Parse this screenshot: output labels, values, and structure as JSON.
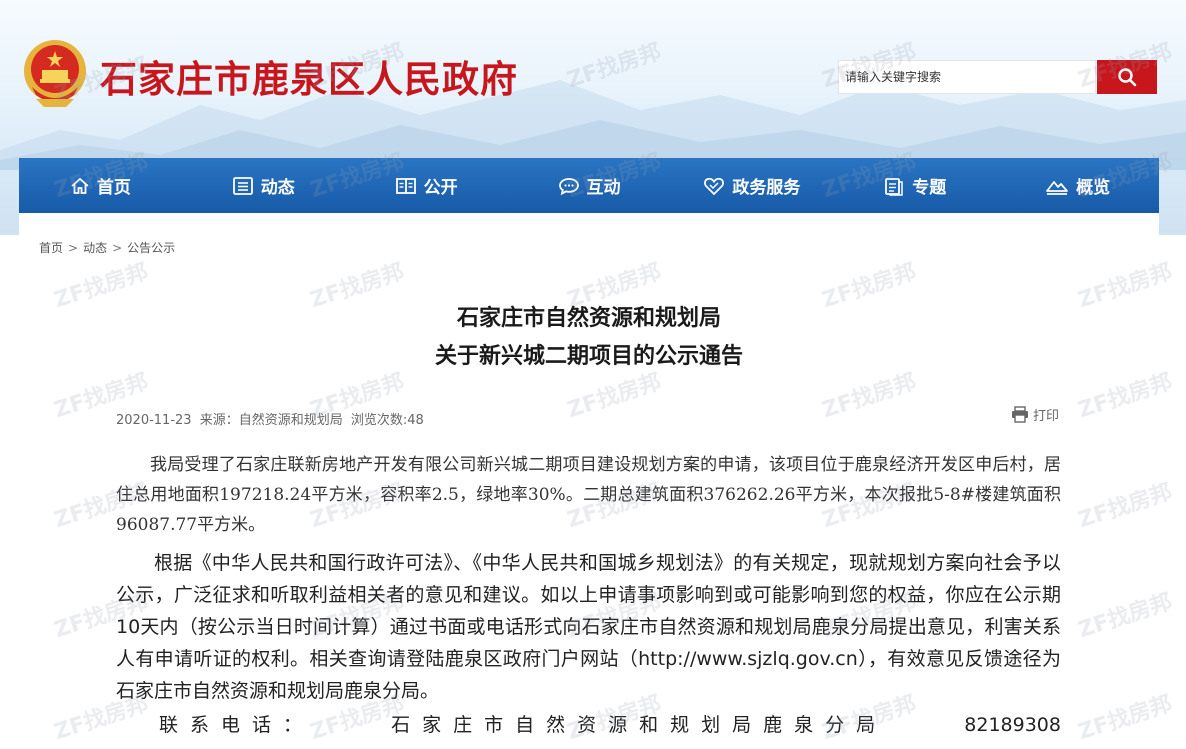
{
  "header": {
    "site_title": "石家庄市鹿泉区人民政府",
    "search_placeholder": "请输入关键字搜索",
    "brand_red": "#c8161d",
    "nav_blue": "#1d63b0"
  },
  "nav": {
    "items": [
      {
        "label": "首页",
        "icon": "home-icon"
      },
      {
        "label": "动态",
        "icon": "news-icon"
      },
      {
        "label": "公开",
        "icon": "book-icon"
      },
      {
        "label": "互动",
        "icon": "chat-icon"
      },
      {
        "label": "政务服务",
        "icon": "heart-icon"
      },
      {
        "label": "专题",
        "icon": "document-icon"
      },
      {
        "label": "概览",
        "icon": "landscape-icon"
      }
    ]
  },
  "breadcrumb": {
    "home": "首页",
    "section": "动态",
    "current": "公告公示",
    "separator": ">"
  },
  "article": {
    "title_line1": "石家庄市自然资源和规划局",
    "title_line2": "关于新兴城二期项目的公示通告",
    "date": "2020-11-23",
    "source": "来源：自然资源和规划局",
    "views": "浏览次数:48",
    "print_label": "打印",
    "paragraph1": "我局受理了石家庄联新房地产开发有限公司新兴城二期项目建设规划方案的申请，该项目位于鹿泉经济开发区申后村，居住总用地面积197218.24平方米，容积率2.5，绿地率30%。二期总建筑面积376262.26平方米，本次报批5-8#楼建筑面积96087.77平方米。",
    "paragraph2": "根据《中华人民共和国行政许可法》、《中华人民共和国城乡规划法》的有关规定，现就规划方案向社会予以公示，广泛征求和听取利益相关者的意见和建议。如以上申请事项影响到或可能影响到您的权益，你应在公示期10天内（按公示当日时间计算）通过书面或电话形式向石家庄市自然资源和规划局鹿泉分局提出意见，利害关系人有申请听证的权利。相关查询请登陆鹿泉区政府门户网站（http://www.sjzlq.gov.cn），有效意见反馈途径为石家庄市自然资源和规划局鹿泉分局。",
    "contact_label": "联系电话：",
    "contact_org": "石家庄市自然资源和规划局鹿泉分局",
    "contact_phone": "82189308"
  },
  "watermark": {
    "text": "ZF找房邦"
  }
}
